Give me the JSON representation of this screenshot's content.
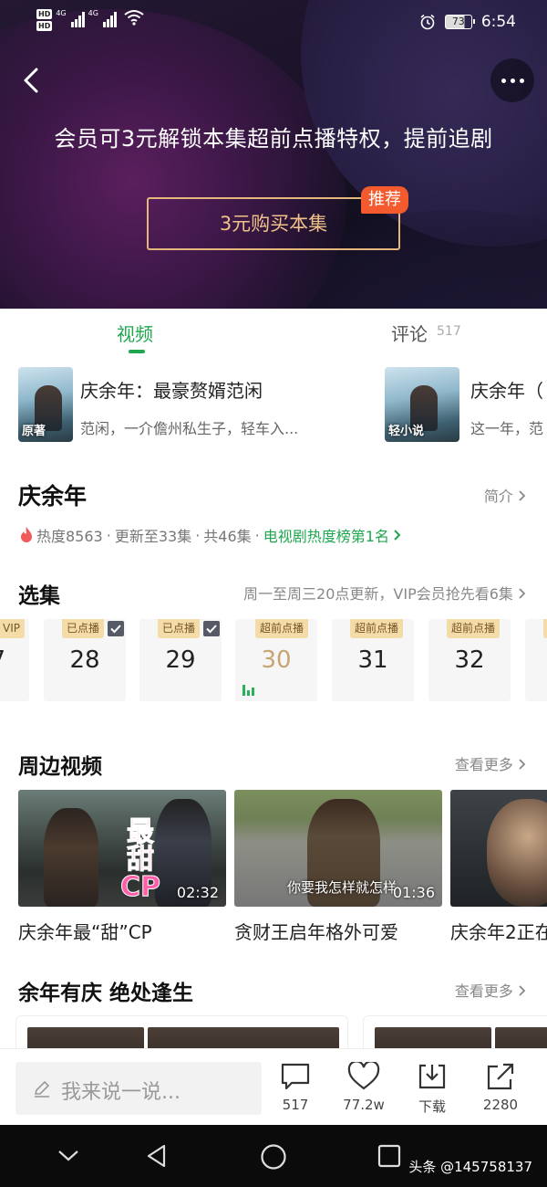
{
  "status_bar": {
    "hd1": "HD",
    "hd2": "HD",
    "net1": "4G",
    "net2": "4G",
    "battery": "73",
    "time": "6:54"
  },
  "hero": {
    "title": "会员可3元解锁本集超前点播特权，提前追剧",
    "buy_label": "3元购买本集",
    "badge": "推荐"
  },
  "tabs": {
    "video": "视频",
    "comment": "评论",
    "comment_count": "517"
  },
  "books": [
    {
      "tag": "原著",
      "title": "庆余年：最豪赘婿范闲",
      "desc": "范闲，一介儋州私生子，轻车入..."
    },
    {
      "tag": "轻小说",
      "title": "庆余年（",
      "desc": "这一年，范"
    }
  ],
  "show": {
    "title": "庆余年",
    "intro_link": "简介",
    "heat": "热度8563",
    "update": "更新至33集",
    "total": "共46集",
    "sep": "·",
    "rank": "电视剧热度榜第1名"
  },
  "episodes": {
    "title": "选集",
    "note": "周一至周三20点更新，VIP会员抢先看6集",
    "items": [
      {
        "num": "7",
        "badge": "VIP"
      },
      {
        "num": "28",
        "badge": "已点播",
        "checked": true
      },
      {
        "num": "29",
        "badge": "已点播",
        "checked": true
      },
      {
        "num": "30",
        "badge": "超前点播",
        "current": true
      },
      {
        "num": "31",
        "badge": "超前点播"
      },
      {
        "num": "32",
        "badge": "超前点播"
      }
    ]
  },
  "nearby": {
    "title": "周边视频",
    "more": "查看更多",
    "videos": [
      {
        "title": "庆余年最“甜”CP",
        "duration": "02:32",
        "caption": "最甜CP"
      },
      {
        "title": "贪财王启年格外可爱",
        "duration": "01:36",
        "caption": "你要我怎样就怎样"
      },
      {
        "title": "庆余年2正在",
        "duration": ""
      }
    ]
  },
  "section2": {
    "title": "余年有庆 绝处逢生",
    "more": "查看更多"
  },
  "comment_bar": {
    "placeholder": "我来说一说...",
    "comments": "517",
    "likes": "77.2w",
    "download": "下载",
    "share": "2280"
  },
  "watermark": "头条 @145758137",
  "colors": {
    "accent_green": "#1fa74f",
    "gold": "#e6b77c",
    "badge_red": "#f35a2d"
  }
}
